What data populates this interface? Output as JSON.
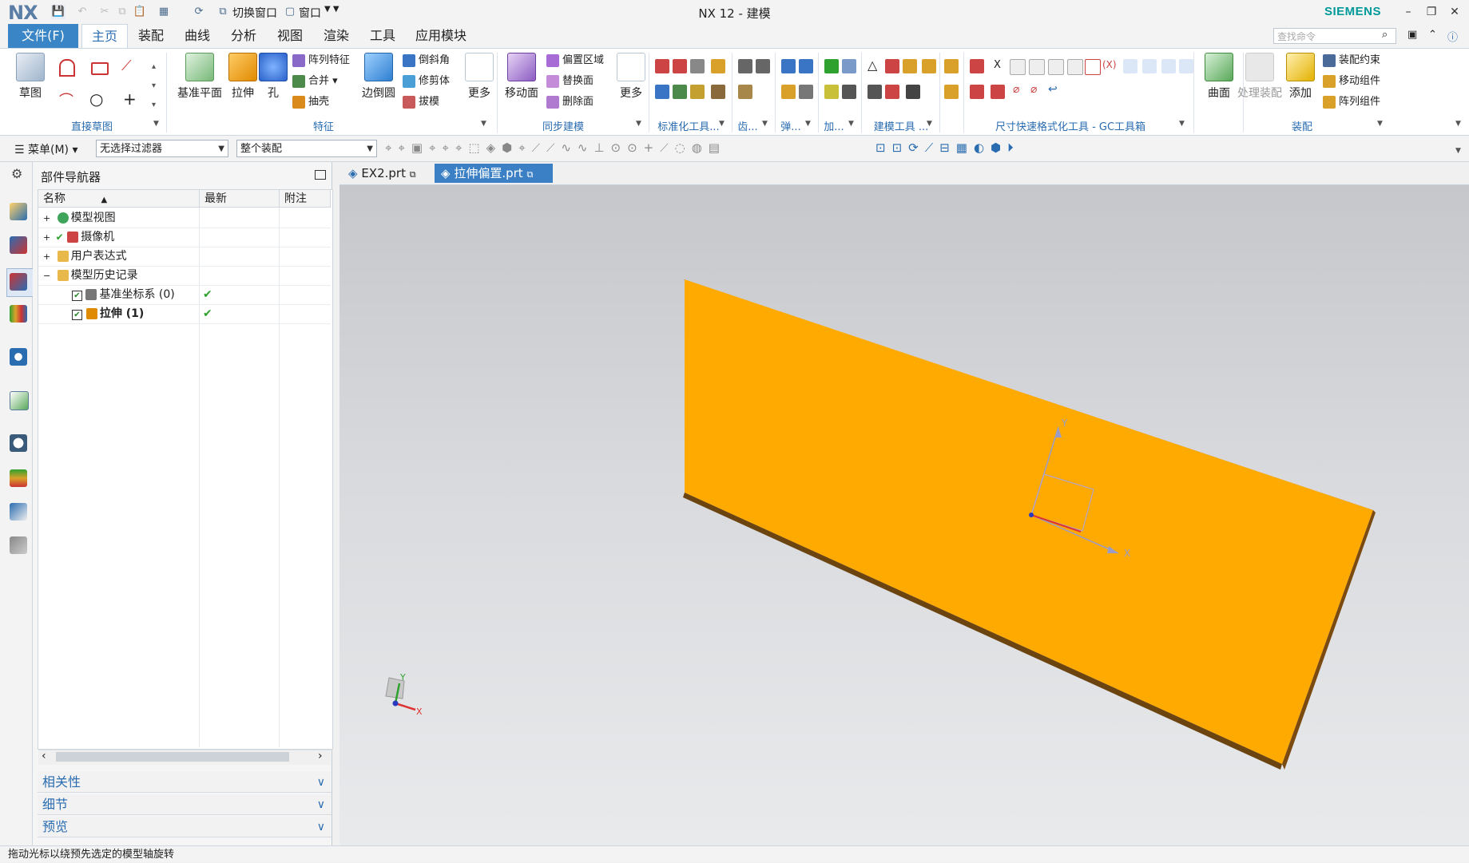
{
  "window": {
    "logo": "NX",
    "title": "NX 12 - 建模",
    "brand": "SIEMENS"
  },
  "quick_access": {
    "switch_window": "切换窗口",
    "window_menu": "窗口"
  },
  "ribbon_tabs": {
    "file": "文件(F)",
    "tabs": [
      "主页",
      "装配",
      "曲线",
      "分析",
      "视图",
      "渲染",
      "工具",
      "应用模块"
    ],
    "active": "主页"
  },
  "command_search": {
    "placeholder": "查找命令"
  },
  "ribbon": {
    "sketch": {
      "big": "草图",
      "group": "直接草图"
    },
    "feature": {
      "datum_plane": "基准平面",
      "extrude": "拉伸",
      "hole": "孔",
      "pattern": "阵列特征",
      "unite": "合并",
      "shell": "抽壳",
      "edge_blend": "边倒圆",
      "chamfer": "倒斜角",
      "trim_body": "修剪体",
      "draft": "拔模",
      "more": "更多",
      "group": "特征"
    },
    "sync": {
      "move_face": "移动面",
      "offset_region": "偏置区域",
      "replace_face": "替换面",
      "delete_face": "删除面",
      "more": "更多",
      "group": "同步建模"
    },
    "groups": [
      "标准化工具...",
      "齿...",
      "弹...",
      "加...",
      "建模工具 ...",
      "尺寸快速格式化工具 - GC工具箱"
    ],
    "surface": {
      "label": "曲面"
    },
    "assembly": {
      "process": "处理装配",
      "add": "添加",
      "constraint": "装配约束",
      "move_comp": "移动组件",
      "pattern_comp": "阵列组件",
      "group": "装配"
    }
  },
  "toolbar2": {
    "menu": "菜单(M)",
    "filter": "无选择过滤器",
    "scope": "整个装配"
  },
  "navigator": {
    "title": "部件导航器",
    "columns": [
      "名称",
      "最新",
      "附注"
    ],
    "rows": [
      {
        "label": "模型视图",
        "latest": ""
      },
      {
        "label": "摄像机",
        "latest": ""
      },
      {
        "label": "用户表达式",
        "latest": ""
      },
      {
        "label": "模型历史记录",
        "latest": ""
      },
      {
        "label": "基准坐标系 (0)",
        "latest": "✔"
      },
      {
        "label": "拉伸 (1)",
        "latest": "✔"
      }
    ],
    "panels": [
      "相关性",
      "细节",
      "预览"
    ]
  },
  "doc_tabs": [
    {
      "label": "EX2.prt"
    },
    {
      "label": "拉伸偏置.prt"
    }
  ],
  "viewport": {
    "axis_labels": {
      "x": "X",
      "y": "Y"
    },
    "part_color": "#ffaa00",
    "part_edge_color": "#6b4410"
  },
  "status": {
    "message": "拖动光标以绕预先选定的模型轴旋转"
  }
}
